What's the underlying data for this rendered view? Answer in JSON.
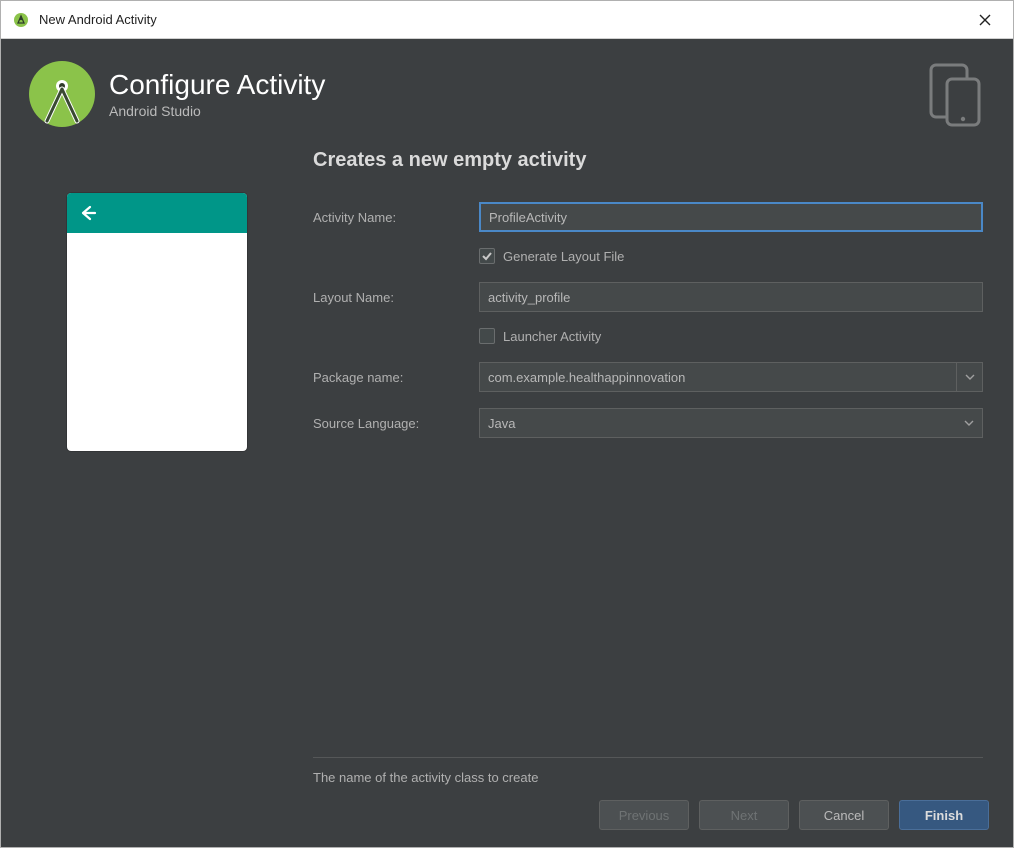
{
  "window": {
    "title": "New Android Activity"
  },
  "header": {
    "title": "Configure Activity",
    "subtitle": "Android Studio"
  },
  "main": {
    "heading": "Creates a new empty activity",
    "labels": {
      "activity_name": "Activity Name:",
      "layout_name": "Layout Name:",
      "package_name": "Package name:",
      "source_language": "Source Language:"
    },
    "values": {
      "activity_name": "ProfileActivity",
      "layout_name": "activity_profile",
      "package_name": "com.example.healthappinnovation",
      "source_language": "Java"
    },
    "checks": {
      "generate_layout": {
        "label": "Generate Layout File",
        "checked": true
      },
      "launcher_activity": {
        "label": "Launcher Activity",
        "checked": false
      }
    },
    "help": "The name of the activity class to create"
  },
  "footer": {
    "previous": "Previous",
    "next": "Next",
    "cancel": "Cancel",
    "finish": "Finish"
  }
}
